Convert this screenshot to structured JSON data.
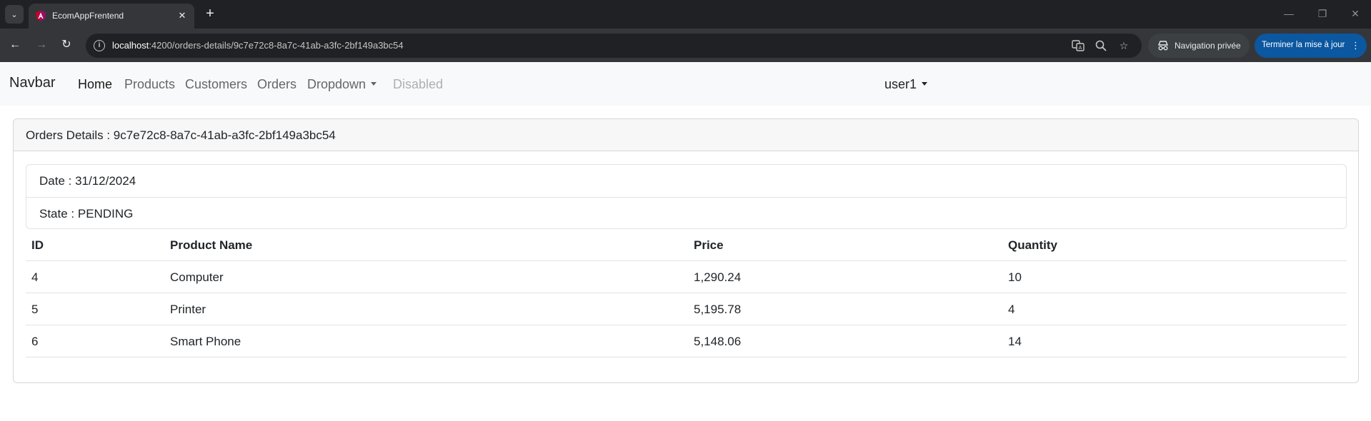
{
  "browser": {
    "tab_title": "EcomAppFrentend",
    "url_host": "localhost",
    "url_path": ":4200/orders-details/9c7e72c8-8a7c-41ab-a3fc-2bf149a3bc54",
    "incognito_label": "Navigation privée",
    "update_label": "Terminer la mise à jour",
    "colors": {
      "update_button": "#0b57a0",
      "tabstrip": "#202124",
      "toolbar": "#35363a"
    }
  },
  "navbar": {
    "brand": "Navbar",
    "links": [
      "Home",
      "Products",
      "Customers",
      "Orders",
      "Dropdown",
      "Disabled"
    ],
    "user": "user1"
  },
  "order": {
    "header": "Orders Details : 9c7e72c8-8a7c-41ab-a3fc-2bf149a3bc54",
    "date": "Date : 31/12/2024",
    "state": "State : PENDING"
  },
  "table": {
    "headers": [
      "ID",
      "Product Name",
      "Price",
      "Quantity"
    ],
    "rows": [
      [
        "4",
        "Computer",
        "1,290.24",
        "10"
      ],
      [
        "5",
        "Printer",
        "5,195.78",
        "4"
      ],
      [
        "6",
        "Smart Phone",
        "5,148.06",
        "14"
      ]
    ]
  }
}
